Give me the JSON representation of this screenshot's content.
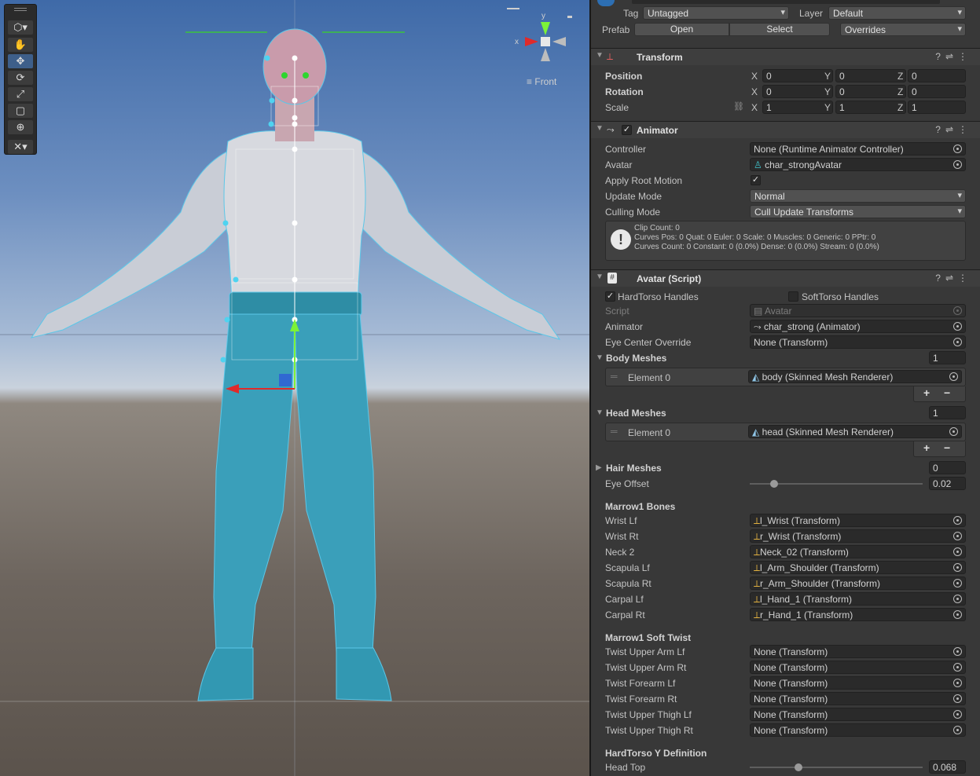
{
  "scene": {
    "view_label": "Front",
    "axis_y": "y",
    "axis_x": "x",
    "tools": [
      "hand-tool",
      "move-tool",
      "rotate-tool",
      "scale-tool",
      "rect-tool",
      "transform-tool",
      "custom-tool"
    ]
  },
  "header": {
    "tag_label": "Tag",
    "tag_value": "Untagged",
    "layer_label": "Layer",
    "layer_value": "Default",
    "prefab_label": "Prefab",
    "open": "Open",
    "select": "Select",
    "overrides": "Overrides"
  },
  "transform": {
    "title": "Transform",
    "position_label": "Position",
    "rotation_label": "Rotation",
    "scale_label": "Scale",
    "x": "X",
    "y": "Y",
    "z": "Z",
    "position": [
      "0",
      "0",
      "0"
    ],
    "rotation": [
      "0",
      "0",
      "0"
    ],
    "scale": [
      "1",
      "1",
      "1"
    ]
  },
  "animator": {
    "title": "Animator",
    "controller_label": "Controller",
    "controller_value": "None (Runtime Animator Controller)",
    "avatar_label": "Avatar",
    "avatar_value": "char_strongAvatar",
    "apply_root_motion_label": "Apply Root Motion",
    "update_mode_label": "Update Mode",
    "update_mode_value": "Normal",
    "culling_mode_label": "Culling Mode",
    "culling_mode_value": "Cull Update Transforms",
    "info_line1": "Clip Count: 0",
    "info_line2": "Curves Pos: 0 Quat: 0 Euler: 0 Scale: 0 Muscles: 0 Generic: 0 PPtr: 0",
    "info_line3": "Curves Count: 0 Constant: 0 (0.0%) Dense: 0 (0.0%) Stream: 0 (0.0%)"
  },
  "avatar_script": {
    "title": "Avatar (Script)",
    "hardtorso_label": "HardTorso Handles",
    "softtorso_label": "SoftTorso Handles",
    "script_label": "Script",
    "script_value": "Avatar",
    "animator_label": "Animator",
    "animator_value": "char_strong (Animator)",
    "eye_center_label": "Eye Center Override",
    "eye_center_value": "None (Transform)",
    "body_meshes_label": "Body Meshes",
    "body_meshes_count": "1",
    "element0_label": "Element 0",
    "body_element0": "body (Skinned Mesh Renderer)",
    "head_meshes_label": "Head Meshes",
    "head_meshes_count": "1",
    "head_element0": "head (Skinned Mesh Renderer)",
    "hair_meshes_label": "Hair Meshes",
    "hair_meshes_count": "0",
    "eye_offset_label": "Eye Offset",
    "eye_offset_value": "0.02",
    "eye_offset_fraction": 0.14,
    "plus": "+",
    "minus": "−"
  },
  "bones": {
    "title": "Marrow1 Bones",
    "items": [
      {
        "label": "Wrist Lf",
        "value": "l_Wrist (Transform)"
      },
      {
        "label": "Wrist Rt",
        "value": "r_Wrist (Transform)"
      },
      {
        "label": "Neck 2",
        "value": "Neck_02 (Transform)"
      },
      {
        "label": "Scapula Lf",
        "value": "l_Arm_Shoulder (Transform)"
      },
      {
        "label": "Scapula Rt",
        "value": "r_Arm_Shoulder (Transform)"
      },
      {
        "label": "Carpal Lf",
        "value": "l_Hand_1 (Transform)"
      },
      {
        "label": "Carpal Rt",
        "value": "r_Hand_1 (Transform)"
      }
    ]
  },
  "soft_twist": {
    "title": "Marrow1 Soft Twist",
    "items": [
      {
        "label": "Twist Upper Arm Lf",
        "value": "None (Transform)"
      },
      {
        "label": "Twist Upper Arm Rt",
        "value": "None (Transform)"
      },
      {
        "label": "Twist Forearm Lf",
        "value": "None (Transform)"
      },
      {
        "label": "Twist Forearm Rt",
        "value": "None (Transform)"
      },
      {
        "label": "Twist Upper Thigh Lf",
        "value": "None (Transform)"
      },
      {
        "label": "Twist Upper Thigh Rt",
        "value": "None (Transform)"
      }
    ]
  },
  "hardtorso_y": {
    "title": "HardTorso Y Definition",
    "head_top_label": "Head Top",
    "head_top_value": "0.068",
    "head_top_fraction": 0.28
  }
}
